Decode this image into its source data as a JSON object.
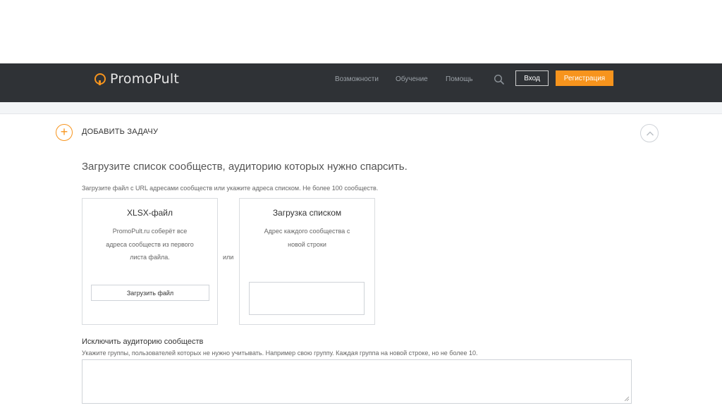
{
  "header": {
    "logo_text": "PromoPult",
    "nav": [
      "Возможности",
      "Обучение",
      "Помощь"
    ],
    "login_label": "Вход",
    "register_label": "Регистрация",
    "accent_color": "#f7941d"
  },
  "task": {
    "add_label": "ДОБАВИТЬ ЗАДАЧУ",
    "lead": "Загрузите список сообществ, аудиторию которых нужно спарсить.",
    "hint": "Загрузите файл с URL адресами сообществ или укажите адреса списком. Не более 100 сообществ."
  },
  "cards": {
    "xlsx": {
      "title": "XLSX-файл",
      "desc_line1": "PromoPult.ru соберёт все",
      "desc_line2": "адреса сообществ из первого",
      "desc_line3": "листа файла.",
      "upload_label": "Загрузить файл"
    },
    "or_label": "или",
    "list": {
      "title": "Загрузка списком",
      "desc_line1": "Адрес каждого сообщества с",
      "desc_line2": "новой строки"
    }
  },
  "exclude": {
    "title": "Исключить аудиторию сообществ",
    "hint": "Укажите группы, пользователей которых не нужно учитывать. Например свою группу. Каждая группа на новой строке, но не более 10."
  }
}
